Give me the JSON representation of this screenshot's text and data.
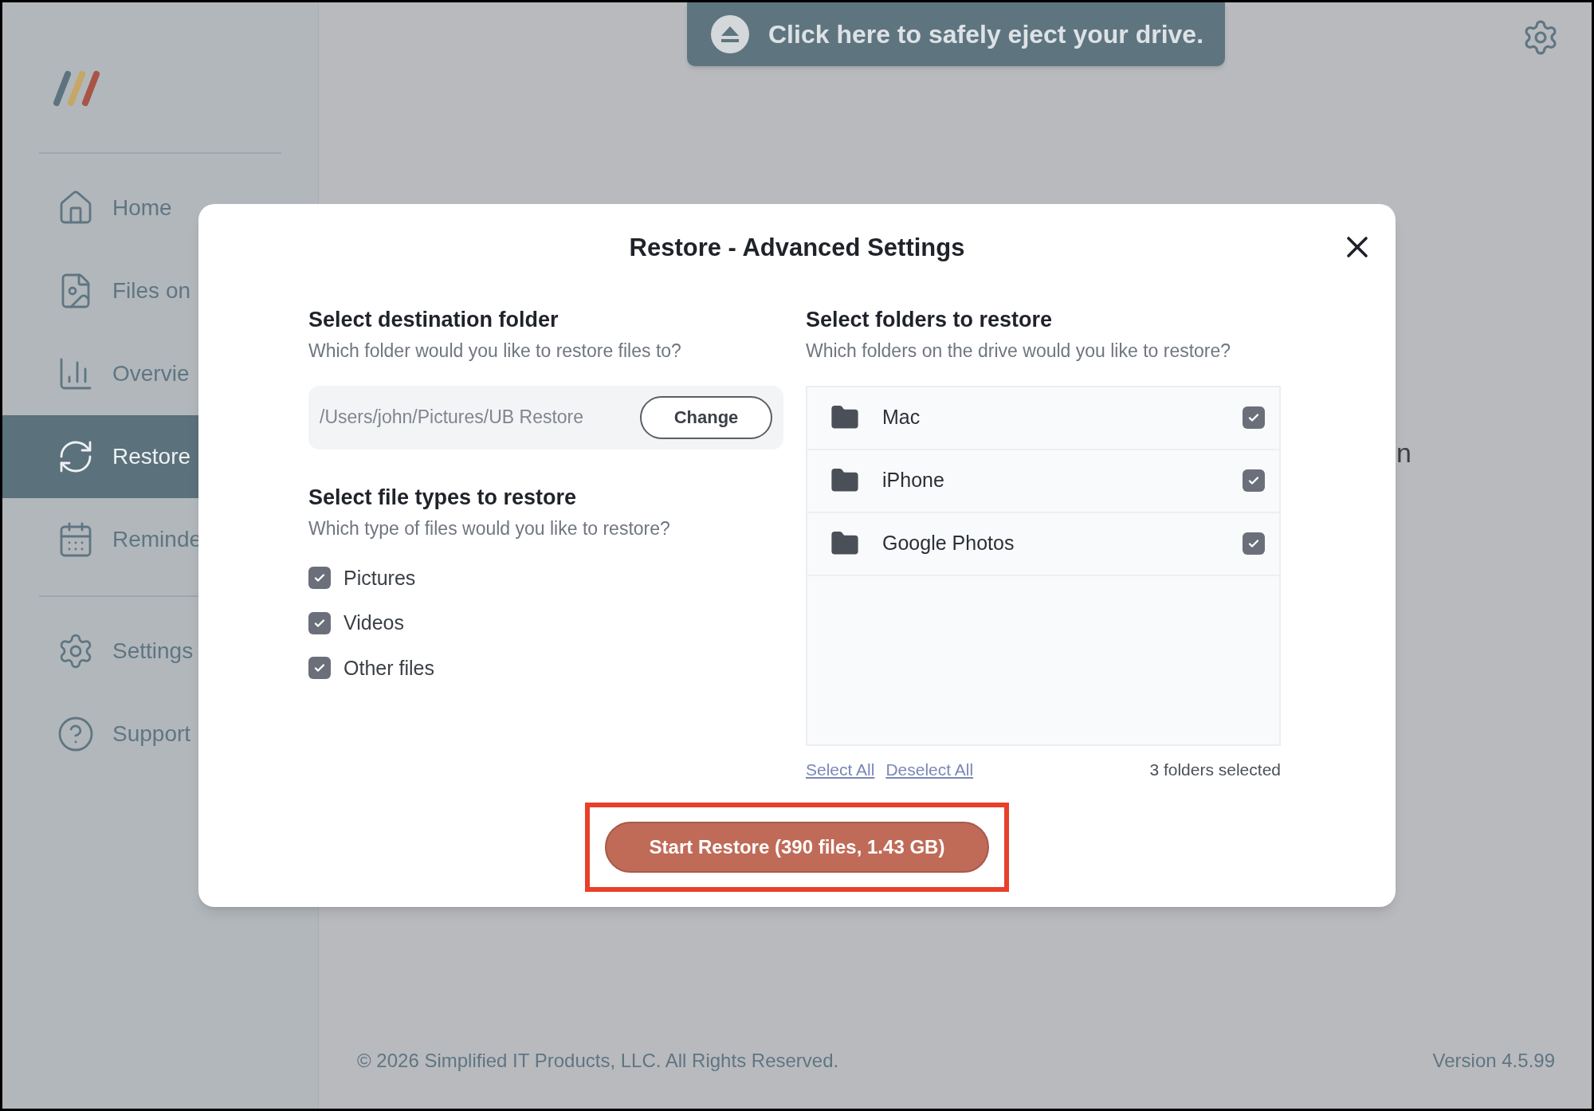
{
  "sidebar": {
    "nav_groups": [
      [
        {
          "label": "Home",
          "selected": false
        },
        {
          "label": "Files on",
          "selected": false
        },
        {
          "label": "Overvie",
          "selected": false
        },
        {
          "label": "Restore",
          "selected": true
        },
        {
          "label": "Reminde",
          "selected": false
        }
      ],
      [
        {
          "label": "Settings",
          "selected": false
        },
        {
          "label": "Support",
          "selected": false
        }
      ]
    ]
  },
  "eject_banner": {
    "label": "Click here to safely eject your drive."
  },
  "main_text_fragment": "n",
  "dialog": {
    "title": "Restore - Advanced Settings",
    "destination": {
      "heading": "Select destination folder",
      "subtitle": "Which folder would you like to restore files to?",
      "path": "/Users/john/Pictures/UB Restore",
      "button": "Change"
    },
    "file_types": {
      "heading": "Select file types to restore",
      "subtitle": "Which type of files would you like to restore?",
      "items": [
        {
          "label": "Pictures",
          "checked": true
        },
        {
          "label": "Videos",
          "checked": true
        },
        {
          "label": "Other files",
          "checked": true
        }
      ]
    },
    "folders": {
      "heading": "Select folders to restore",
      "subtitle": "Which folders on the drive would you like to restore?",
      "items": [
        {
          "label": "Mac",
          "checked": true
        },
        {
          "label": "iPhone",
          "checked": true
        },
        {
          "label": "Google Photos",
          "checked": true
        }
      ],
      "select_all": "Select All",
      "deselect_all": "Deselect All",
      "count": "3 folders selected"
    },
    "start_button": {
      "label": "Start Restore (390 files, 1.43 GB)",
      "highlighted": true
    }
  },
  "footer": {
    "copyright": "© 2026 Simplified IT Products, LLC. All Rights Reserved.",
    "version": "Version 4.5.99"
  }
}
